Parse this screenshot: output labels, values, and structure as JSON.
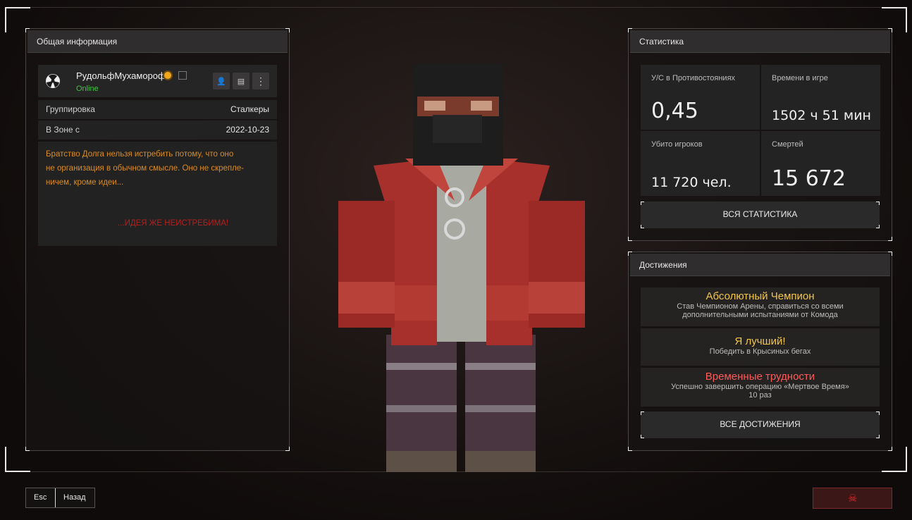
{
  "colors": {
    "online": "#43c443",
    "about_text": "#d98c22",
    "quote": "#b3201f",
    "gold_title": "#f2c64a",
    "red_title": "#ff5a5a"
  },
  "general": {
    "title": "Общая информация",
    "profile": {
      "name": "РудольфМухамороф",
      "status": "Online",
      "avatar_icon": "radiation-icon",
      "badge_icon": "rank-badge-icon",
      "copy_icon": "copy-icon",
      "add_friend_icon": "add-friend-icon",
      "chat_icon": "chat-icon",
      "more_icon": "more-vertical-icon"
    },
    "faction_label": "Группировка",
    "faction_value": "Сталкеры",
    "zone_label": "В Зоне с",
    "zone_value": "2022-10-23",
    "about_line1": "Братство Долга нельзя истребить потому, что оно",
    "about_line2": "не организация в обычном смысле. Оно не скрепле-",
    "about_line3": "ничем, кроме идеи...",
    "about_quote": "...ИДЕЯ ЖЕ НЕИСТРЕБИМА!"
  },
  "stats": {
    "title": "Статистика",
    "kd_label": "У/С в Противостояниях",
    "kd_value": "0,45",
    "time_label": "Времени в игре",
    "time_value": "1502 ч 51 мин",
    "kills_label": "Убито игроков",
    "kills_value": "11 720 чел.",
    "deaths_label": "Смертей",
    "deaths_value": "15 672",
    "all_button": "ВСЯ СТАТИСТИКА"
  },
  "achievements": {
    "title": "Достижения",
    "items": [
      {
        "title": "Абсолютный Чемпион",
        "desc1": "Став Чемпионом Арены, справиться со всеми",
        "desc2": "дополнительными испытаниями от Комода"
      },
      {
        "title": "Я лучший!",
        "desc1": "Победить в Крысиных бегах",
        "desc2": ""
      },
      {
        "title": "Временные трудности",
        "desc1": "Успешно завершить операцию «Мертвое Время»",
        "desc2": "10 раз"
      }
    ],
    "all_button": "ВСЕ ДОСТИЖЕНИЯ"
  },
  "footer": {
    "esc_key": "Esc",
    "back_label": "Назад",
    "report_icon": "skull-crossbones-icon"
  }
}
